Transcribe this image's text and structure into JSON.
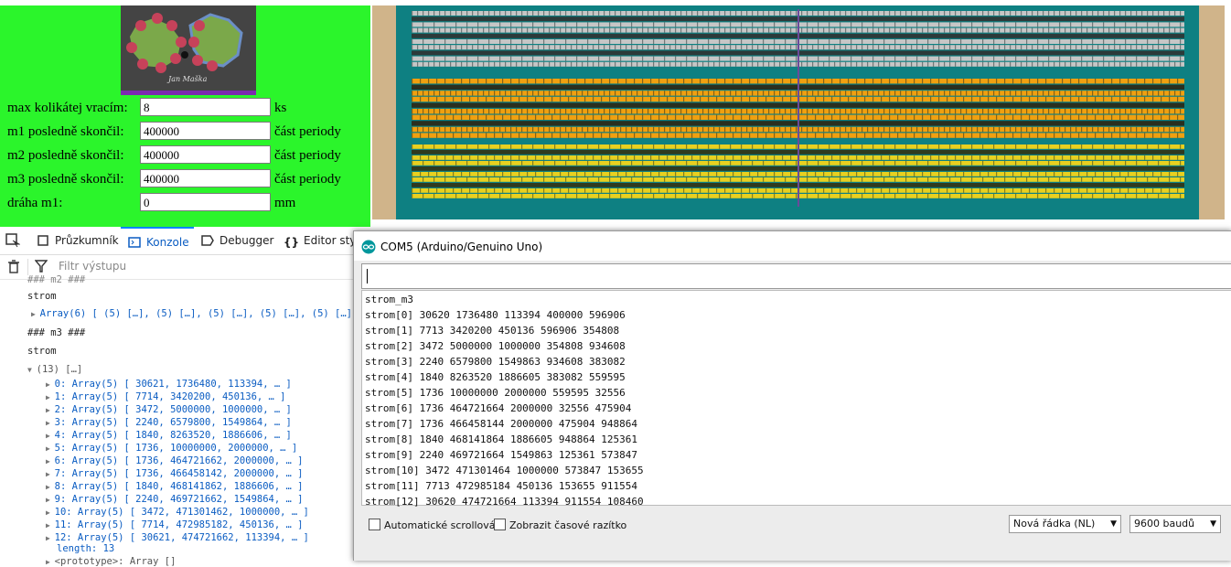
{
  "form": {
    "rows": [
      {
        "label": "max kolikátej vracím:",
        "value": "8",
        "unit": "ks"
      },
      {
        "label": "m1 posledně skončil:",
        "value": "400000",
        "unit": "část periody"
      },
      {
        "label": "m2 posledně skončil:",
        "value": "400000",
        "unit": "část periody"
      },
      {
        "label": "m3 posledně skončil:",
        "value": "400000",
        "unit": "část periody"
      },
      {
        "label": "dráha m1:",
        "value": "0",
        "unit": "mm"
      }
    ]
  },
  "devtools": {
    "tabs": [
      "Průzkumník",
      "Konzole",
      "Debugger",
      "Editor stylů"
    ],
    "active_tab": "Konzole",
    "filter_placeholder": "Filtr výstupu",
    "console": {
      "line_top_cut": "### m2 ###",
      "label1": "strom",
      "array_collapsed": "Array(6) [ (5) […], (5) […], (5) […], (5) […], (5) […], (",
      "m3_header": "### m3 ###",
      "label2": "strom",
      "array_expanded": "(13) […]",
      "items": [
        "0: Array(5) [ 30621, 1736480, 113394, … ]",
        "1: Array(5) [ 7714, 3420200, 450136, … ]",
        "2: Array(5) [ 3472, 5000000, 1000000, … ]",
        "3: Array(5) [ 2240, 6579800, 1549864, … ]",
        "4: Array(5) [ 1840, 8263520, 1886606, … ]",
        "5: Array(5) [ 1736, 10000000, 2000000, … ]",
        "6: Array(5) [ 1736, 464721662, 2000000, … ]",
        "7: Array(5) [ 1736, 466458142, 2000000, … ]",
        "8: Array(5) [ 1840, 468141862, 1886606, … ]",
        "9: Array(5) [ 2240, 469721662, 1549864, … ]",
        "10: Array(5) [ 3472, 471301462, 1000000, … ]",
        "11: Array(5) [ 7714, 472985182, 450136, … ]",
        "12: Array(5) [ 30621, 474721662, 113394, … ]"
      ],
      "length": "length: 13",
      "prototype": "<prototype>: Array []"
    }
  },
  "serial": {
    "title": "COM5 (Arduino/Genuino Uno)",
    "input_value": "",
    "lines": [
      "strom_m3",
      "strom[0] 30620 1736480 113394 400000 596906",
      "strom[1] 7713 3420200 450136 596906 354808",
      "strom[2] 3472 5000000 1000000 354808 934608",
      "strom[3] 2240 6579800 1549863 934608 383082",
      "strom[4] 1840 8263520 1886605 383082 559595",
      "strom[5] 1736 10000000 2000000 559595 32556",
      "strom[6] 1736 464721664 2000000 32556 475904",
      "strom[7] 1736 466458144 2000000 475904 948864",
      "strom[8] 1840 468141864 1886605 948864 125361",
      "strom[9] 2240 469721664 1549863 125361 573847",
      "strom[10] 3472 471301464 1000000 573847 153655",
      "strom[11] 7713 472985184 450136 153655 911554",
      "strom[12] 30620 474721664 113394 911554 108460"
    ],
    "autoscroll_label": "Automatické scrollování",
    "timestamp_label": "Zobrazit časové razítko",
    "line_ending": "Nová řádka (NL)",
    "baud": "9600 baudů"
  },
  "logo": {
    "signature": "Jan Maška"
  }
}
